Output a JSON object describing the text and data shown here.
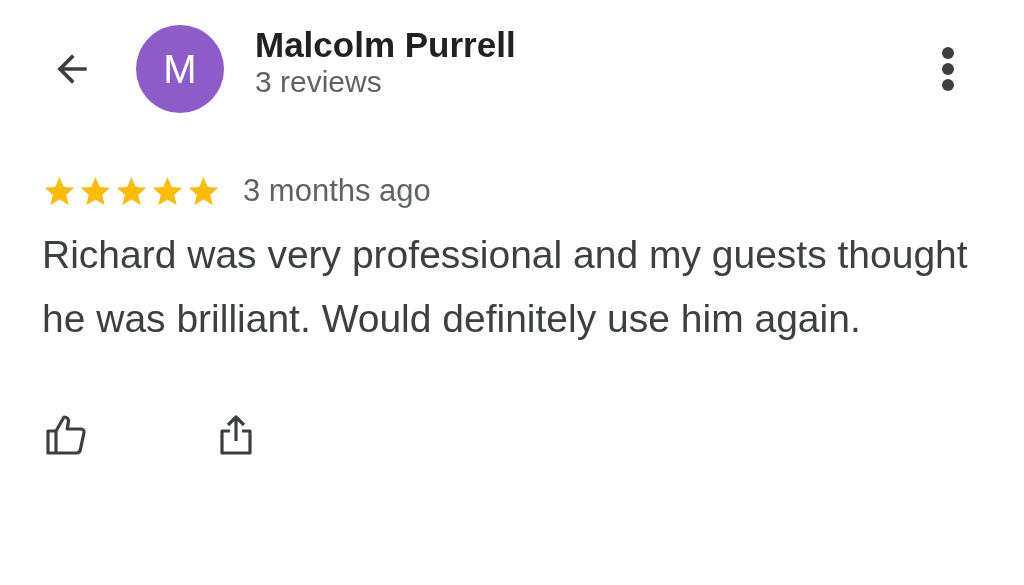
{
  "reviewer": {
    "initial": "M",
    "name": "Malcolm Purrell",
    "reviews": "3 reviews"
  },
  "review": {
    "stars": 5,
    "time": "3 months ago",
    "text": "Richard was very professional and my guests thought he was brilliant. Would definitely use him again."
  }
}
